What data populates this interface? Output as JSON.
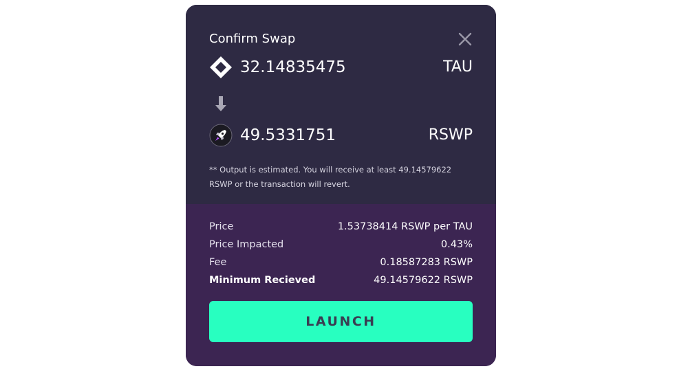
{
  "modal": {
    "title": "Confirm Swap",
    "close_icon": "close-icon"
  },
  "from": {
    "icon": "tau-diamond-icon",
    "amount": "32.14835475",
    "symbol": "TAU"
  },
  "swap_arrow_icon": "arrow-down-icon",
  "to": {
    "icon": "rocket-icon",
    "amount": "49.5331751",
    "symbol": "RSWP"
  },
  "note": {
    "line1": "** Output is estimated. You will receive at least 49.14579622",
    "line2": "RSWP or the transaction will revert."
  },
  "details": [
    {
      "label": "Price",
      "value": "1.53738414 RSWP per TAU"
    },
    {
      "label": "Price Impacted",
      "value": "0.43%"
    },
    {
      "label": "Fee",
      "value": "0.18587283 RSWP"
    },
    {
      "label": "Minimum Recieved",
      "value": "49.14579622 RSWP"
    }
  ],
  "launch_label": "LAUNCH",
  "colors": {
    "top_panel": "#2e2a43",
    "bottom_panel": "#3c2552",
    "accent_button": "#28ffc0",
    "button_text": "#3a3d52",
    "text": "#ffffff"
  }
}
